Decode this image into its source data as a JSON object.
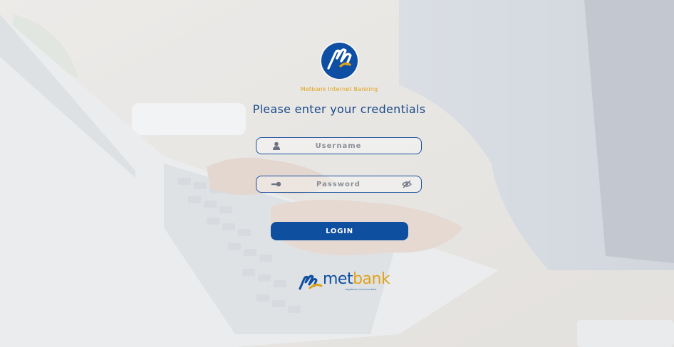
{
  "brand": {
    "logo_icon": "metbank-logo-icon",
    "caption": "Metbank Internet Banking",
    "footer_word_left": "met",
    "footer_word_right": "bank",
    "footer_tagline": "Registered Commercial Bank"
  },
  "login_form": {
    "heading": "Please enter your credentials",
    "username": {
      "placeholder": "Username",
      "value": "",
      "icon": "user-icon"
    },
    "password": {
      "placeholder": "Password",
      "value": "",
      "icon": "key-icon",
      "toggle_icon": "eye-slash-icon"
    },
    "submit_label": "LOGIN"
  },
  "colors": {
    "primary": "#0f4fa0",
    "accent": "#e0a21a",
    "heading": "#1a4a8a"
  }
}
